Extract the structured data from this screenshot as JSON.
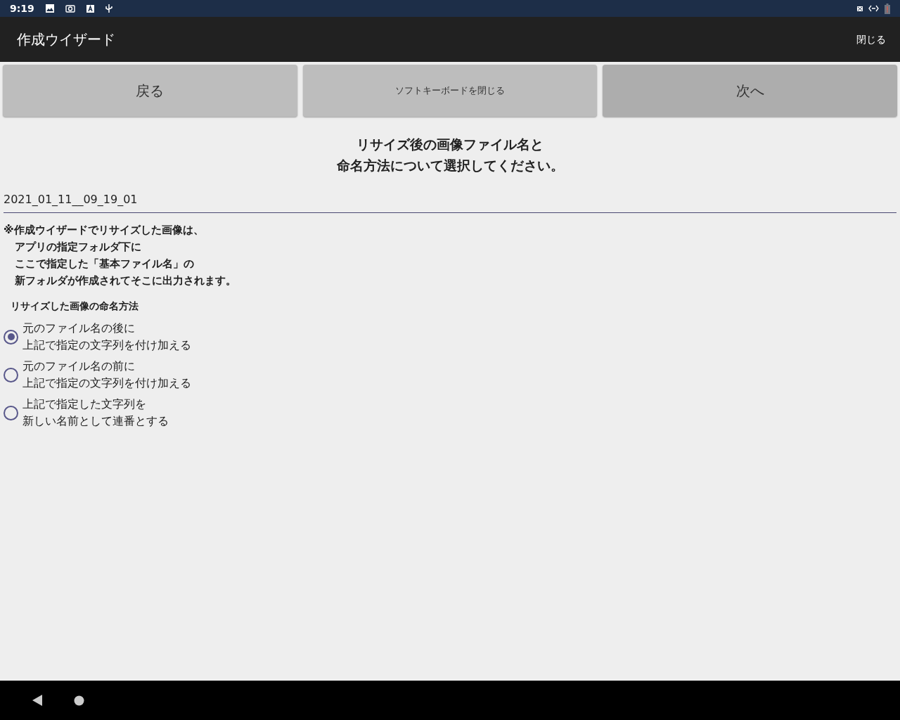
{
  "status_bar": {
    "time": "9:19"
  },
  "app_bar": {
    "title": "作成ウイザード",
    "close_label": "閉じる"
  },
  "buttons": [
    {
      "label": "戻る",
      "focused": false,
      "kind": "nav"
    },
    {
      "label": "ソフトキーボードを閉じる",
      "focused": false,
      "kind": "keyboard"
    },
    {
      "label": "次へ",
      "focused": true,
      "kind": "nav"
    }
  ],
  "heading_lines": [
    "リサイズ後の画像ファイル名と",
    "命名方法について選択してください。"
  ],
  "filename_field": {
    "value": "2021_01_11__09_19_01"
  },
  "note_lines": [
    "※作成ウイザードでリサイズした画像は、",
    "アプリの指定フォルダ下に",
    "ここで指定した「基本ファイル名」の",
    "新フォルダが作成されてそこに出力されます。"
  ],
  "naming": {
    "label": "リサイズした画像の命名方法",
    "options": [
      {
        "lines": [
          "元のファイル名の後に",
          "上記で指定の文字列を付け加える"
        ],
        "selected": true
      },
      {
        "lines": [
          "元のファイル名の前に",
          "上記で指定の文字列を付け加える"
        ],
        "selected": false
      },
      {
        "lines": [
          "上記で指定した文字列を",
          "新しい名前として連番とする"
        ],
        "selected": false
      }
    ]
  }
}
